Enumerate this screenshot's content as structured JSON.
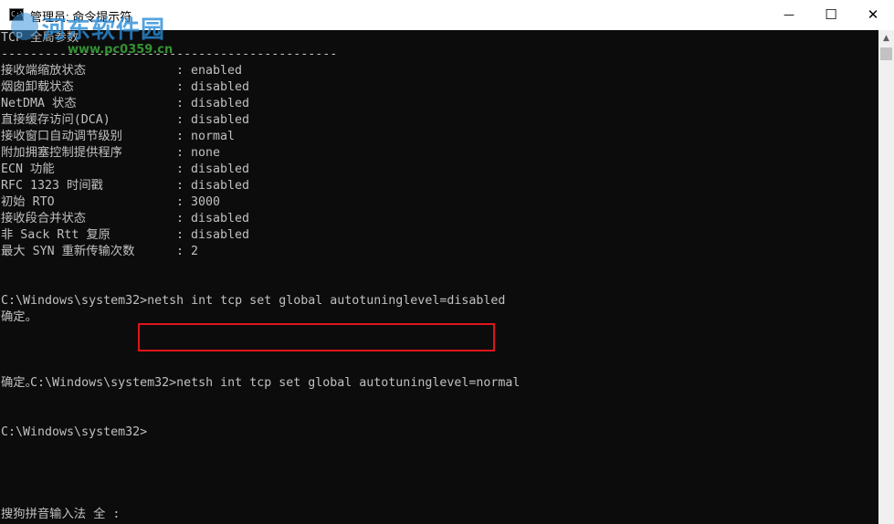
{
  "window": {
    "title": "管理员: 命令提示符",
    "icon_label": "C:\\",
    "buttons": {
      "minimize": "—",
      "maximize": "☐",
      "close": "✕"
    }
  },
  "watermark": {
    "text": "河东软件园",
    "url": "www.pc0359.cn"
  },
  "console": {
    "header": "TCP 全局参数",
    "divider": "----------------------------------------------",
    "separator": ":",
    "params": [
      {
        "label": "接收端缩放状态",
        "value": "enabled"
      },
      {
        "label": "烟囱卸载状态",
        "value": "disabled"
      },
      {
        "label": "NetDMA 状态",
        "value": "disabled"
      },
      {
        "label": "直接缓存访问(DCA)",
        "value": "disabled"
      },
      {
        "label": "接收窗口自动调节级别",
        "value": "normal"
      },
      {
        "label": "附加拥塞控制提供程序",
        "value": "none"
      },
      {
        "label": "ECN 功能",
        "value": "disabled"
      },
      {
        "label": "RFC 1323 时间戳",
        "value": "disabled"
      },
      {
        "label": "初始 RTO",
        "value": "3000"
      },
      {
        "label": "接收段合并状态",
        "value": "disabled"
      },
      {
        "label": "非 Sack Rtt 复原",
        "value": "disabled"
      },
      {
        "label": "最大 SYN 重新传输次数",
        "value": "2"
      }
    ],
    "command1": "C:\\Windows\\system32>netsh int tcp set global autotuninglevel=disabled",
    "result1": "确定。",
    "prompt2": "C:\\Windows\\system32>",
    "command2": "netsh int tcp set global autotuninglevel=normal",
    "result2": "确定。",
    "prompt3": "C:\\Windows\\system32>",
    "ime_status": "搜狗拼音输入法 全 :"
  },
  "colors": {
    "console_bg": "#0c0c0c",
    "console_text": "#c0c0c0",
    "highlight_border": "#e0141b"
  }
}
